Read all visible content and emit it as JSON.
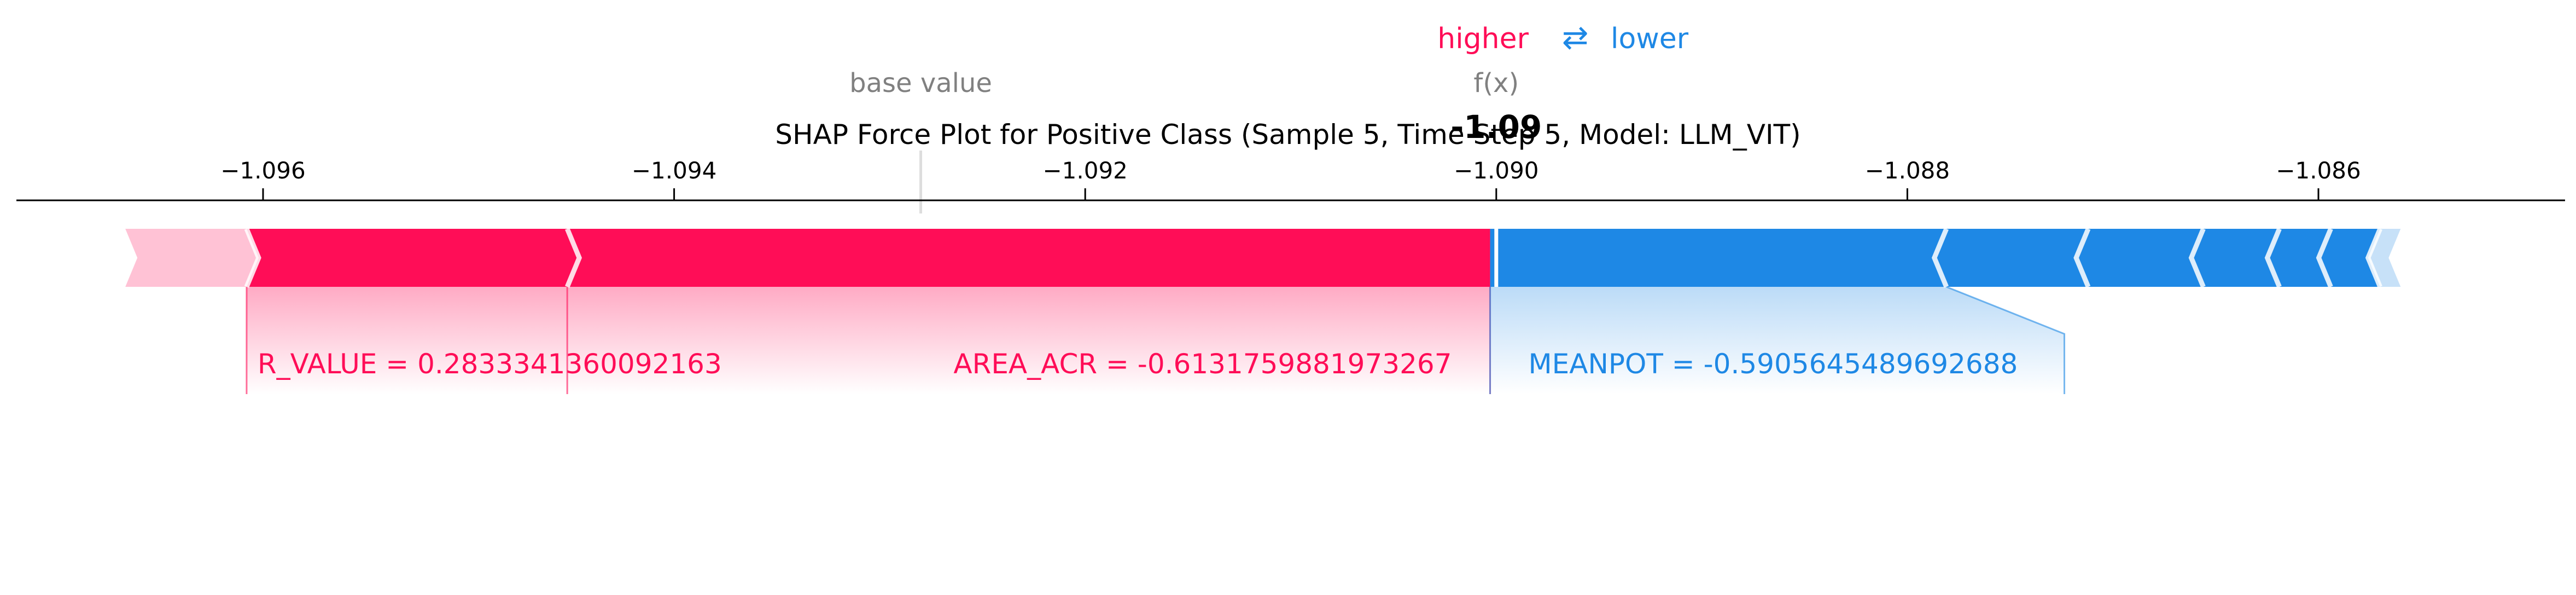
{
  "chart_data": {
    "type": "shap-force",
    "title": "SHAP Force Plot for Positive Class (Sample 5, Time Step 5, Model: LLM_VIT)",
    "base_value": -1.0928,
    "base_value_label": "base value",
    "fx_label": "f(x)",
    "fx_value": -1.09,
    "fx_value_text": "-1.09",
    "higher_label": "higher",
    "lower_label": "lower",
    "arrows_glyph": "⇄",
    "xlim": [
      -1.0972,
      -1.0848
    ],
    "ticks": [
      {
        "value": -1.096,
        "label": "−1.096"
      },
      {
        "value": -1.094,
        "label": "−1.094"
      },
      {
        "value": -1.092,
        "label": "−1.092"
      },
      {
        "value": -1.09,
        "label": "−1.090"
      },
      {
        "value": -1.088,
        "label": "−1.088"
      },
      {
        "value": -1.086,
        "label": "−1.086"
      }
    ],
    "positive_segments": [
      {
        "start": -1.09667,
        "end": -1.09608,
        "label": ""
      },
      {
        "start": -1.09608,
        "end": -1.09452,
        "label": "R_VALUE = 0.2833341360092163"
      },
      {
        "start": -1.09452,
        "end": -1.09003,
        "label": "AREA_ACR = -0.6131759881973267"
      }
    ],
    "negative_segments": [
      {
        "start": -1.09003,
        "end": -1.08781,
        "label": "MEANPOT = -0.5905645489692688"
      },
      {
        "start": -1.08781,
        "end": -1.08712,
        "label": ""
      },
      {
        "start": -1.08712,
        "end": -1.08656,
        "label": ""
      },
      {
        "start": -1.08656,
        "end": -1.08619,
        "label": ""
      },
      {
        "start": -1.08619,
        "end": -1.08594,
        "label": ""
      },
      {
        "start": -1.08594,
        "end": -1.0857,
        "label": ""
      },
      {
        "start": -1.0857,
        "end": -1.0856,
        "label": ""
      }
    ],
    "colors": {
      "positive": "#ff0d57",
      "negative": "#1e88e5",
      "text": "#000000",
      "muted": "#808080"
    }
  }
}
